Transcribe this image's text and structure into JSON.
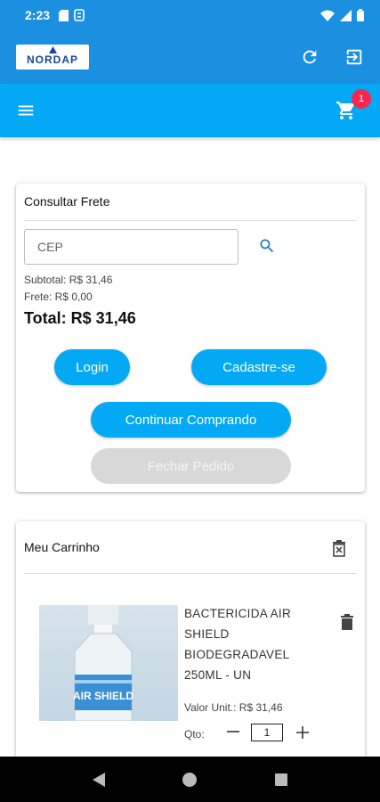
{
  "status_bar": {
    "time": "2:23"
  },
  "app_bar": {
    "logo_text": "NORDAP"
  },
  "cart": {
    "badge_count": "1"
  },
  "freight": {
    "title": "Consultar Frete",
    "cep_placeholder": "CEP",
    "subtotal": "Subtotal: R$ 31,46",
    "frete": "Frete: R$ 0,00",
    "total": "Total: R$ 31,46",
    "login_label": "Login",
    "signup_label": "Cadastre-se",
    "continue_label": "Continuar Comprando",
    "close_order_label": "Fechar Pedido"
  },
  "cart_card": {
    "title": "Meu Carrinho",
    "items": [
      {
        "name": "BACTERICIDA AIR SHIELD BIODEGRADAVEL 250ML - UN",
        "unit_price": "Valor Unit.: R$ 31,46",
        "qty_label": "Qto:",
        "quantity": "1",
        "image_label": "AIR SHIELD"
      }
    ]
  },
  "colors": {
    "primary": "#1b8fe0",
    "accent": "#03a9f4",
    "badge": "#f4284e",
    "disabled": "#d8d8d8"
  }
}
